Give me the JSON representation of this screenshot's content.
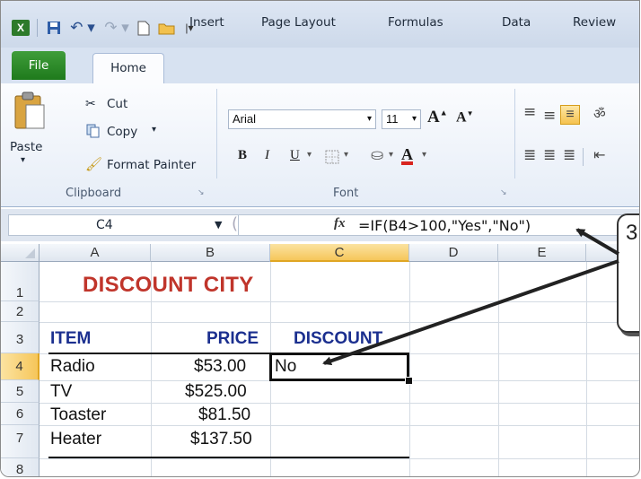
{
  "app": {
    "icon": "excel-icon"
  },
  "qat": {
    "icons": [
      "excel-icon",
      "save-icon",
      "undo-icon",
      "redo-icon",
      "new-document-icon",
      "open-folder-icon",
      "customize-qat-icon"
    ]
  },
  "tabs": {
    "file": "File",
    "home": "Home",
    "insert": "Insert",
    "page_layout": "Page Layout",
    "formulas": "Formulas",
    "data": "Data",
    "review": "Review"
  },
  "clipboard": {
    "paste": "Paste",
    "cut": "Cut",
    "copy": "Copy",
    "format_painter": "Format Painter",
    "group_label": "Clipboard"
  },
  "font": {
    "name": "Arial",
    "size": "11",
    "bold": "B",
    "italic": "I",
    "underline": "U",
    "font_color_letter": "A",
    "grow": "A",
    "shrink": "A",
    "group_label": "Font"
  },
  "formula_bar": {
    "name_box": "C4",
    "fx": "fx",
    "formula": "=IF(B4>100,\"Yes\",\"No\")"
  },
  "columns": [
    "A",
    "B",
    "C",
    "D",
    "E"
  ],
  "rows": [
    "1",
    "2",
    "3",
    "4",
    "5",
    "6",
    "7",
    "8"
  ],
  "sheet": {
    "title": "DISCOUNT CITY",
    "headers": {
      "item": "ITEM",
      "price": "PRICE",
      "discount": "DISCOUNT"
    },
    "items": [
      {
        "item": "Radio",
        "price": "$53.00",
        "discount": "No"
      },
      {
        "item": "TV",
        "price": "$525.00",
        "discount": ""
      },
      {
        "item": "Toaster",
        "price": "$81.50",
        "discount": ""
      },
      {
        "item": "Heater",
        "price": "$137.50",
        "discount": ""
      }
    ]
  },
  "callout": {
    "number": "3"
  },
  "colors": {
    "title": "#c0352b",
    "header": "#1b2f8f",
    "selected_header": "#f6c65a",
    "file_tab": "#2e8b2a"
  }
}
